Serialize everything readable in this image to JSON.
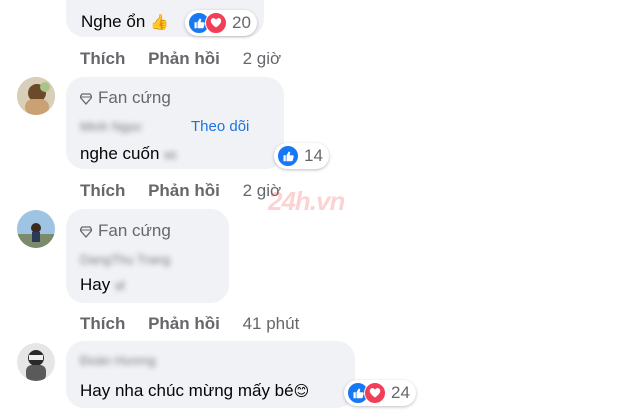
{
  "comments": [
    {
      "text": "Nghe ổn",
      "emoji": "👍",
      "reaction_count": "20",
      "reactions": [
        "like-icon",
        "love-icon"
      ],
      "actions": {
        "like": "Thích",
        "reply": "Phản hồi",
        "time": "2 giờ"
      }
    },
    {
      "badge": "Fan cứng",
      "name": "Minh Ngọc",
      "follow": "Theo dõi",
      "text": "nghe cuốn",
      "blurred_suffix": "vc",
      "reaction_count": "14",
      "reactions": [
        "like-icon"
      ],
      "actions": {
        "like": "Thích",
        "reply": "Phản hồi",
        "time": "2 giờ"
      }
    },
    {
      "badge": "Fan cứng",
      "name": "DangThu Trang",
      "text": "Hay",
      "blurred_suffix": "vl",
      "actions": {
        "like": "Thích",
        "reply": "Phản hồi",
        "time": "41 phút"
      }
    },
    {
      "name": "Đoàn Hương",
      "text": "Hay nha chúc mừng mấy bé",
      "emoji": "😊",
      "reaction_count": "24",
      "reactions": [
        "like-icon",
        "love-icon"
      ]
    }
  ],
  "watermark": "24h.vn",
  "colors": {
    "like": "#1877f2",
    "love": "#f33e58",
    "link": "#1b74e4",
    "meta": "#65676b",
    "bubble": "#f0f2f5"
  }
}
